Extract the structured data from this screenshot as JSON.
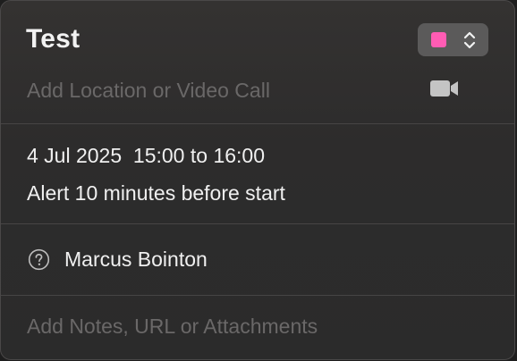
{
  "event": {
    "title": "Test",
    "location_placeholder": "Add Location or Video Call",
    "datetime": "4 Jul 2025  15:00 to 16:00",
    "alert": "Alert 10 minutes before start",
    "organizer": "Marcus Bointon",
    "notes_placeholder": "Add Notes, URL or Attachments"
  },
  "calendar_color": "#ff5cb4",
  "icons": {
    "color_picker": "updown-chevron-icon",
    "video": "video-camera-icon",
    "organizer": "question-circle-icon"
  }
}
